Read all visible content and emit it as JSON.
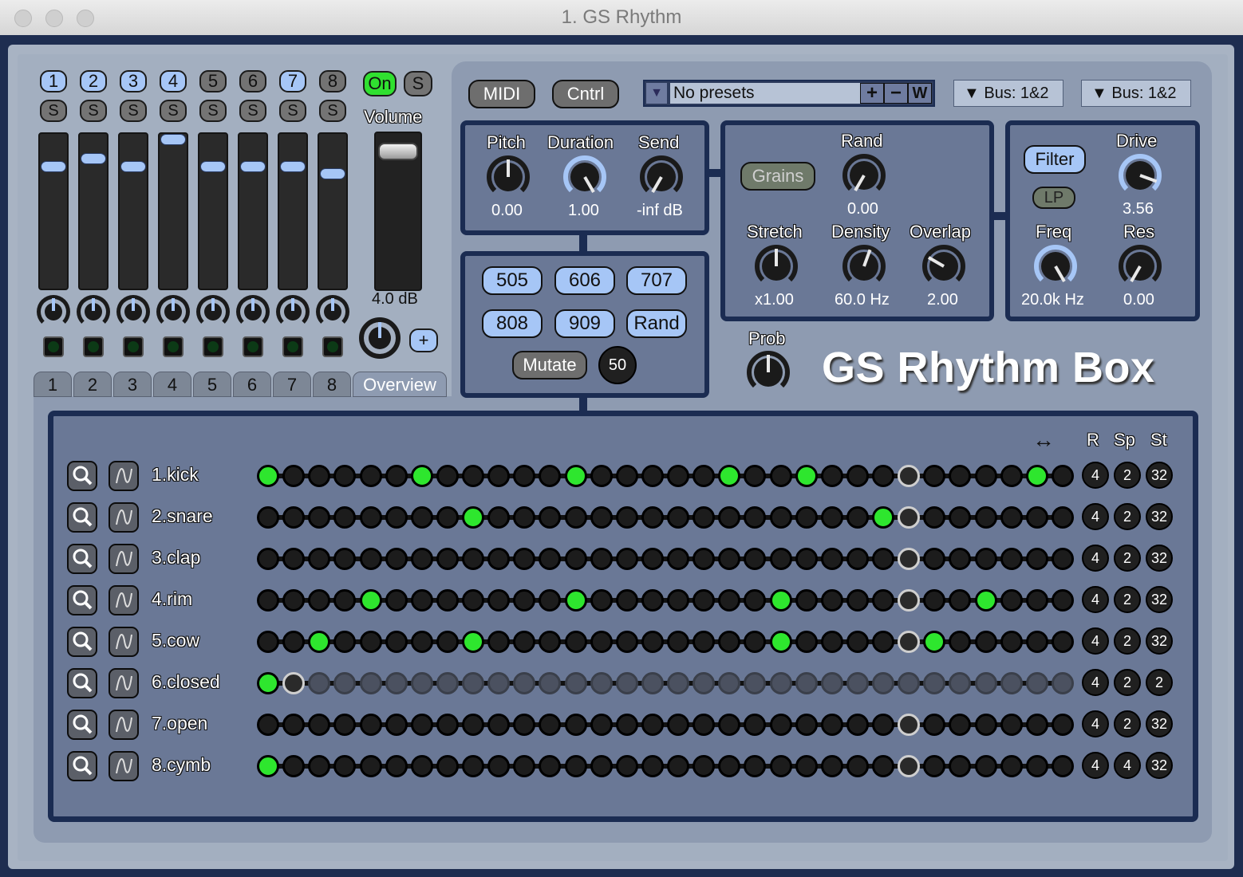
{
  "window": {
    "title": "1. GS Rhythm"
  },
  "channels": [
    {
      "number": "1",
      "solo": "S",
      "active": true,
      "fader_level": 0.8
    },
    {
      "number": "2",
      "solo": "S",
      "active": true,
      "fader_level": 0.86
    },
    {
      "number": "3",
      "solo": "S",
      "active": true,
      "fader_level": 0.8
    },
    {
      "number": "4",
      "solo": "S",
      "active": true,
      "fader_level": 1.0
    },
    {
      "number": "5",
      "solo": "S",
      "active": false,
      "fader_level": 0.8
    },
    {
      "number": "6",
      "solo": "S",
      "active": false,
      "fader_level": 0.8
    },
    {
      "number": "7",
      "solo": "S",
      "active": true,
      "fader_level": 0.8
    },
    {
      "number": "8",
      "solo": "S",
      "active": false,
      "fader_level": 0.75
    }
  ],
  "master": {
    "on_label": "On",
    "solo_label": "S",
    "volume_label": "Volume",
    "volume_value": "4.0 dB",
    "add_label": "+"
  },
  "tabs": [
    "1",
    "2",
    "3",
    "4",
    "5",
    "6",
    "7",
    "8",
    "Overview"
  ],
  "toolbar": {
    "midi": "MIDI",
    "cntrl": "Cntrl",
    "preset_arrow": "▼",
    "preset": "No presets",
    "preset_add": "+",
    "preset_remove": "−",
    "preset_write": "W",
    "bus1": "▼  Bus: 1&2",
    "bus2": "▼  Bus: 1&2"
  },
  "voice": {
    "pitch_label": "Pitch",
    "pitch_value": "0.00",
    "duration_label": "Duration",
    "duration_value": "1.00",
    "send_label": "Send",
    "send_value": "-inf dB"
  },
  "kits": {
    "k505": "505",
    "k606": "606",
    "k707": "707",
    "k808": "808",
    "k909": "909",
    "rand": "Rand",
    "mutate": "Mutate",
    "mutate_amount": "50"
  },
  "grains": {
    "grains_label": "Grains",
    "rand_label": "Rand",
    "rand_value": "0.00",
    "stretch_label": "Stretch",
    "stretch_value": "x1.00",
    "density_label": "Density",
    "density_value": "60.0 Hz",
    "overlap_label": "Overlap",
    "overlap_value": "2.00"
  },
  "filter": {
    "filter_label": "Filter",
    "mode_label": "LP",
    "drive_label": "Drive",
    "drive_value": "3.56",
    "freq_label": "Freq",
    "freq_value": "20.0k Hz",
    "res_label": "Res",
    "res_value": "0.00"
  },
  "prob_label": "Prob",
  "app_title": "GS Rhythm Box",
  "sequencer": {
    "header": {
      "arrows": "↔",
      "r": "R",
      "sp": "Sp",
      "st": "St"
    },
    "playhead": 25,
    "tracks": [
      {
        "name": "1.kick",
        "on": [
          0,
          6,
          12,
          18,
          21,
          30
        ],
        "r": "4",
        "sp": "2",
        "st": "32",
        "length": 32
      },
      {
        "name": "2.snare",
        "on": [
          8,
          24
        ],
        "r": "4",
        "sp": "2",
        "st": "32",
        "length": 32
      },
      {
        "name": "3.clap",
        "on": [],
        "r": "4",
        "sp": "2",
        "st": "32",
        "length": 32
      },
      {
        "name": "4.rim",
        "on": [
          4,
          12,
          20,
          28
        ],
        "r": "4",
        "sp": "2",
        "st": "32",
        "length": 32
      },
      {
        "name": "5.cow",
        "on": [
          2,
          8,
          20,
          26
        ],
        "r": "4",
        "sp": "2",
        "st": "32",
        "length": 32
      },
      {
        "name": "6.closed",
        "on": [
          0
        ],
        "r": "4",
        "sp": "2",
        "st": "2",
        "length": 2
      },
      {
        "name": "7.open",
        "on": [],
        "r": "4",
        "sp": "2",
        "st": "32",
        "length": 32
      },
      {
        "name": "8.cymb",
        "on": [
          0
        ],
        "r": "4",
        "sp": "4",
        "st": "32",
        "length": 32
      }
    ]
  },
  "colors": {
    "accent_blue": "#a6c6f6",
    "step_on": "#2ee62e",
    "panel": "#6a7896",
    "frame": "#1b2c52"
  }
}
